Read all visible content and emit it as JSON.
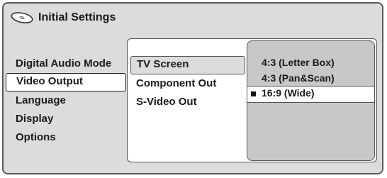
{
  "header": {
    "icon": "disc-icon",
    "title": "Initial Settings"
  },
  "main_menu": {
    "items": [
      {
        "label": "Digital Audio Mode",
        "selected": false
      },
      {
        "label": "Video Output",
        "selected": true
      },
      {
        "label": "Language",
        "selected": false
      },
      {
        "label": "Display",
        "selected": false
      },
      {
        "label": "Options",
        "selected": false
      }
    ]
  },
  "sub_menu": {
    "items": [
      {
        "label": "TV Screen",
        "selected": true
      },
      {
        "label": "Component Out",
        "selected": false
      },
      {
        "label": "S-Video Out",
        "selected": false
      }
    ]
  },
  "options": {
    "items": [
      {
        "label": "4:3 (Letter Box)",
        "selected": false
      },
      {
        "label": "4:3 (Pan&Scan)",
        "selected": false
      },
      {
        "label": "16:9 (Wide)",
        "selected": true
      }
    ]
  },
  "colors": {
    "panel_bg": "#dcdcdc",
    "options_bg": "#c8c8c8",
    "highlight_bg": "#ffffff"
  }
}
